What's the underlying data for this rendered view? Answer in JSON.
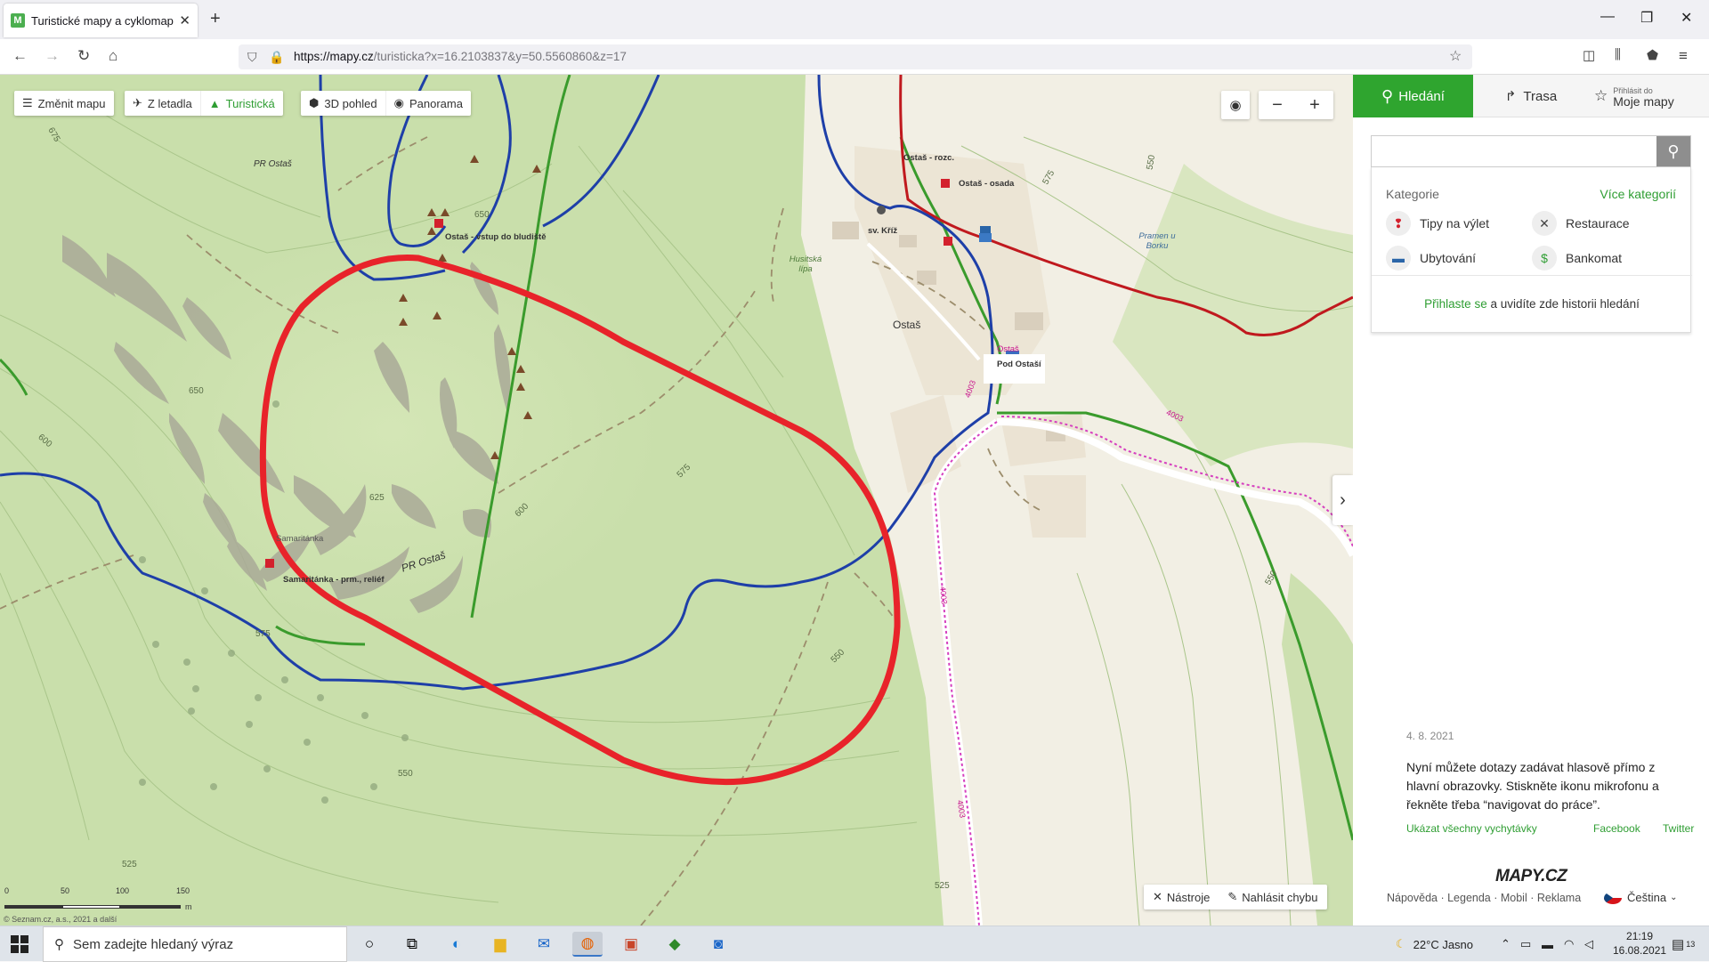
{
  "browser": {
    "tab_title": "Turistické mapy a cyklomapy •",
    "favicon_letter": "M",
    "url_host": "https://mapy.cz",
    "url_path": "/turisticka?x=16.2103837&y=50.5560860&z=17"
  },
  "map_toolbar": {
    "change_map": "Změnit mapu",
    "aerial": "Z letadla",
    "tourist": "Turistická",
    "view3d": "3D pohled",
    "panorama": "Panorama"
  },
  "map_labels": {
    "pr_ostas_top": "PR Ostaš",
    "pr_ostas_bottom": "PR Ostaš",
    "vstup": "Ostaš - vstup do bludiště",
    "rozc": "Ostaš - rozc.",
    "osada": "Ostaš - osada",
    "sv_kriz": "sv. Kříž",
    "husitska_lipa": "Husitská lípa",
    "pramen": "Pramen u Borku",
    "ostas_village": "Ostaš",
    "ostas_stop": "Ostaš",
    "pod_ostasi": "Pod Ostaší",
    "samaritanka": "Samaritánka",
    "samaritanka_relief": "Samaritánka - prm., reliéf"
  },
  "contour_labels": [
    "675",
    "650",
    "650",
    "600",
    "625",
    "600",
    "575",
    "575",
    "550",
    "550",
    "525",
    "525",
    "550",
    "575",
    "550",
    "600"
  ],
  "road_numbers": [
    "4003",
    "4003",
    "4003",
    "4003"
  ],
  "scale": {
    "labels": [
      "0",
      "50",
      "100",
      "150"
    ],
    "unit": "m"
  },
  "copyright": "© Seznam.cz, a.s., 2021 a další",
  "map_bottom_tools": {
    "tools": "Nástroje",
    "report": "Nahlásit chybu"
  },
  "panel": {
    "tab_search": "Hledání",
    "tab_route": "Trasa",
    "tab_mymaps_small": "Přihlásit do",
    "tab_mymaps": "Moje mapy",
    "search_placeholder": "",
    "categories_title": "Kategorie",
    "more_categories": "Více kategorií",
    "categories": [
      "Tipy na výlet",
      "Restaurace",
      "Ubytování",
      "Bankomat"
    ],
    "login_link": "Přihlaste se",
    "login_rest": " a uvidíte zde historii hledání",
    "news_date": "4. 8. 2021",
    "news_text": "Nyní můžete dotazy zadávat hlasově přímo z hlavní obrazovky. Stiskněte ikonu mikrofonu a řekněte třeba “navigovat do práce”.",
    "news_all": "Ukázat všechny vychytávky",
    "facebook": "Facebook",
    "twitter": "Twitter",
    "brand": "MAPY.CZ",
    "footer": "Nápověda · Legenda · Mobil · Reklama",
    "language": "Čeština"
  },
  "taskbar": {
    "search_placeholder": "Sem zadejte hledaný výraz",
    "weather": "22°C  Jasno",
    "time": "21:19",
    "date": "16.08.2021",
    "notifications": "13"
  },
  "colors": {
    "map_bg": "#c9dfab",
    "annotation": "#e8232a",
    "blue_trail": "#1e3fa8",
    "green_trail": "#2f8a2a",
    "red_trail": "#c0191e",
    "accent": "#2fa52f"
  }
}
